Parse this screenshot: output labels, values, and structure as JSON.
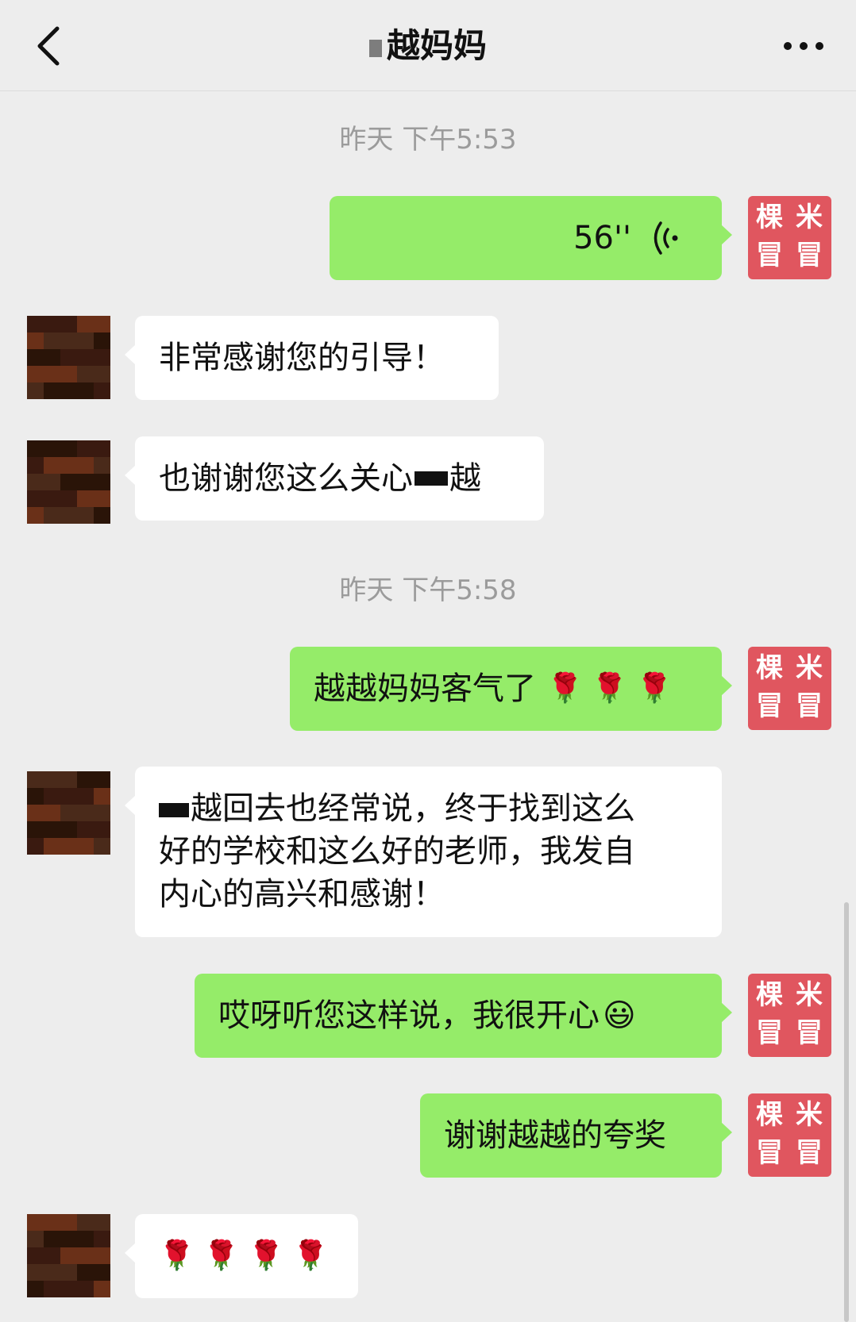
{
  "header": {
    "title": "越妈妈"
  },
  "messages": [
    {
      "type": "time",
      "text": "昨天 下午5:53"
    },
    {
      "type": "voice",
      "from": "me",
      "duration": "56''"
    },
    {
      "type": "text",
      "from": "other",
      "text": "非常感谢您的引导！"
    },
    {
      "type": "text",
      "from": "other",
      "text_before": "也谢谢您这么关心",
      "text_after": "越"
    },
    {
      "type": "time",
      "text": "昨天 下午5:58"
    },
    {
      "type": "text",
      "from": "me",
      "text": "越越妈妈客气了",
      "emoji": "🌹 🌹 🌹"
    },
    {
      "type": "text",
      "from": "other",
      "lines": [
        "越回去也经常说，终于找到这么",
        "好的学校和这么好的老师，我发自",
        "内心的高兴和感谢！"
      ]
    },
    {
      "type": "text",
      "from": "me",
      "text": "哎呀听您这样说，我很开心",
      "emoji": "😃"
    },
    {
      "type": "text",
      "from": "me",
      "text": "谢谢越越的夸奖"
    },
    {
      "type": "emoji",
      "from": "other",
      "emoji": "🌹 🌹 🌹 🌹"
    }
  ],
  "my_avatar": {
    "glyphs": [
      "棵",
      "米",
      "冒",
      "冒"
    ],
    "color": "#e0565f"
  },
  "colors": {
    "me_bubble": "#95ec69",
    "other_bubble": "#ffffff",
    "background": "#ededed"
  }
}
